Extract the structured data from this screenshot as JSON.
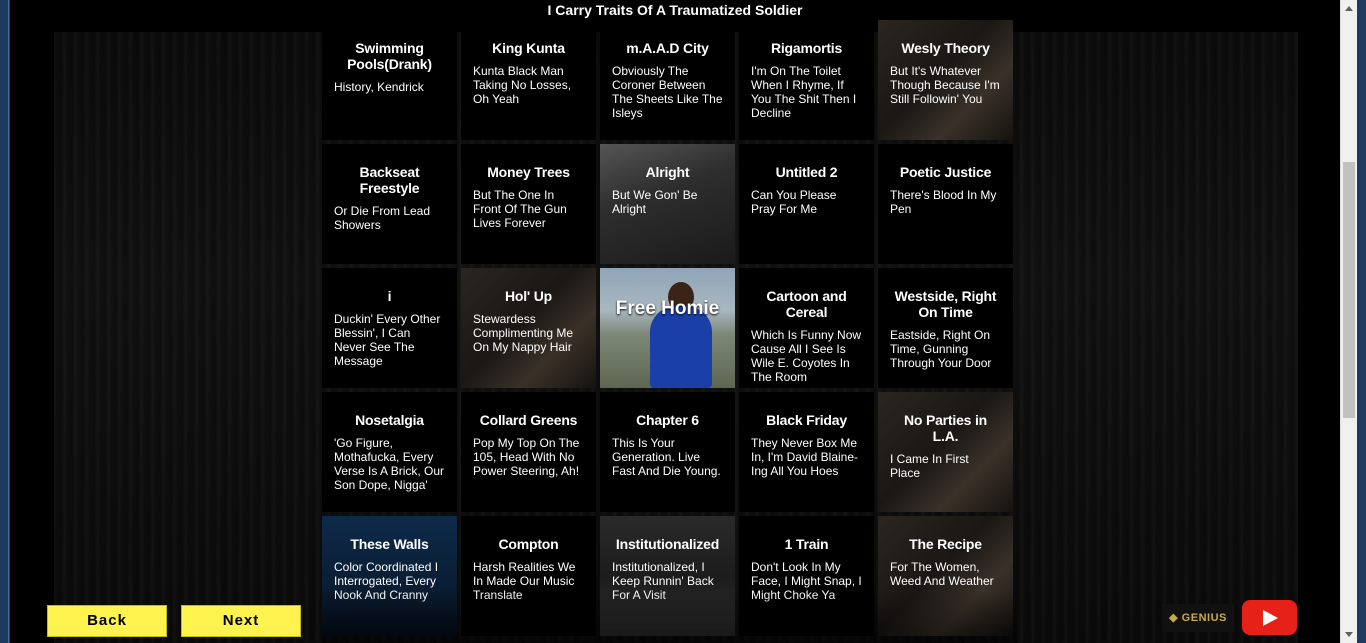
{
  "page": {
    "header_title": "I Carry Traits Of A Traumatized Soldier"
  },
  "tiles": [
    {
      "title": "Swimming Pools(Drank)",
      "lyric": "History, Kendrick"
    },
    {
      "title": "King Kunta",
      "lyric": "Kunta Black Man Taking No Losses, Oh Yeah"
    },
    {
      "title": "m.A.A.D City",
      "lyric": "Obviously The Coroner Between The Sheets Like The Isleys"
    },
    {
      "title": "Rigamortis",
      "lyric": "I'm On The Toilet When I Rhyme, If You The Shit Then I Decline"
    },
    {
      "title": "Wesly Theory",
      "lyric": "But It's Whatever Though Because I'm Still Followin' You"
    },
    {
      "title": "Backseat Freestyle",
      "lyric": "Or Die From Lead Showers"
    },
    {
      "title": "Money Trees",
      "lyric": "But The One In Front Of The Gun Lives Forever"
    },
    {
      "title": "Alright",
      "lyric": "But We Gon' Be Alright"
    },
    {
      "title": "Untitled 2",
      "lyric": "Can You Please Pray For Me"
    },
    {
      "title": "Poetic Justice",
      "lyric": "There's Blood In My Pen"
    },
    {
      "title": "i",
      "lyric": "Duckin' Every Other Blessin', I Can Never See The Message"
    },
    {
      "title": "Hol' Up",
      "lyric": "Stewardess Complimenting Me On My Nappy Hair"
    },
    {
      "title": "Free Homie",
      "lyric": ""
    },
    {
      "title": "Cartoon and Cereal",
      "lyric": "Which Is Funny Now Cause All I See Is Wile E. Coyotes In The Room"
    },
    {
      "title": "Westside, Right On Time",
      "lyric": "Eastside, Right On Time, Gunning Through Your Door"
    },
    {
      "title": "Nosetalgia",
      "lyric": "'Go Figure, Mothafucka, Every Verse Is A Brick, Our Son Dope, Nigga'"
    },
    {
      "title": "Collard Greens",
      "lyric": "Pop My Top On The 105, Head With No Power Steering, Ah!"
    },
    {
      "title": "Chapter 6",
      "lyric": "This Is Your Generation. Live Fast And Die Young."
    },
    {
      "title": "Black Friday",
      "lyric": "They Never Box Me In, I'm David Blaine-Ing All You Hoes"
    },
    {
      "title": "No Parties in L.A.",
      "lyric": "I Came In First Place"
    },
    {
      "title": "These Walls",
      "lyric": "Color Coordinated I Interrogated, Every Nook And Cranny"
    },
    {
      "title": "Compton",
      "lyric": "Harsh Realities We In Made Our Music Translate"
    },
    {
      "title": "Institutionalized",
      "lyric": "Institutionalized, I Keep Runnin' Back For A Visit"
    },
    {
      "title": "1 Train",
      "lyric": "Don't Look In My Face, I Might Snap, I Might Choke Ya"
    },
    {
      "title": "The Recipe",
      "lyric": "For The Women, Weed And Weather"
    }
  ],
  "nav": {
    "back_label": "Back",
    "next_label": "Next"
  },
  "footer": {
    "genius_label": "GENIUS",
    "youtube_icon": "youtube-play-icon"
  },
  "colors": {
    "button_yellow": "#fff44f",
    "youtube_red": "#e62117",
    "background": "#000000"
  }
}
